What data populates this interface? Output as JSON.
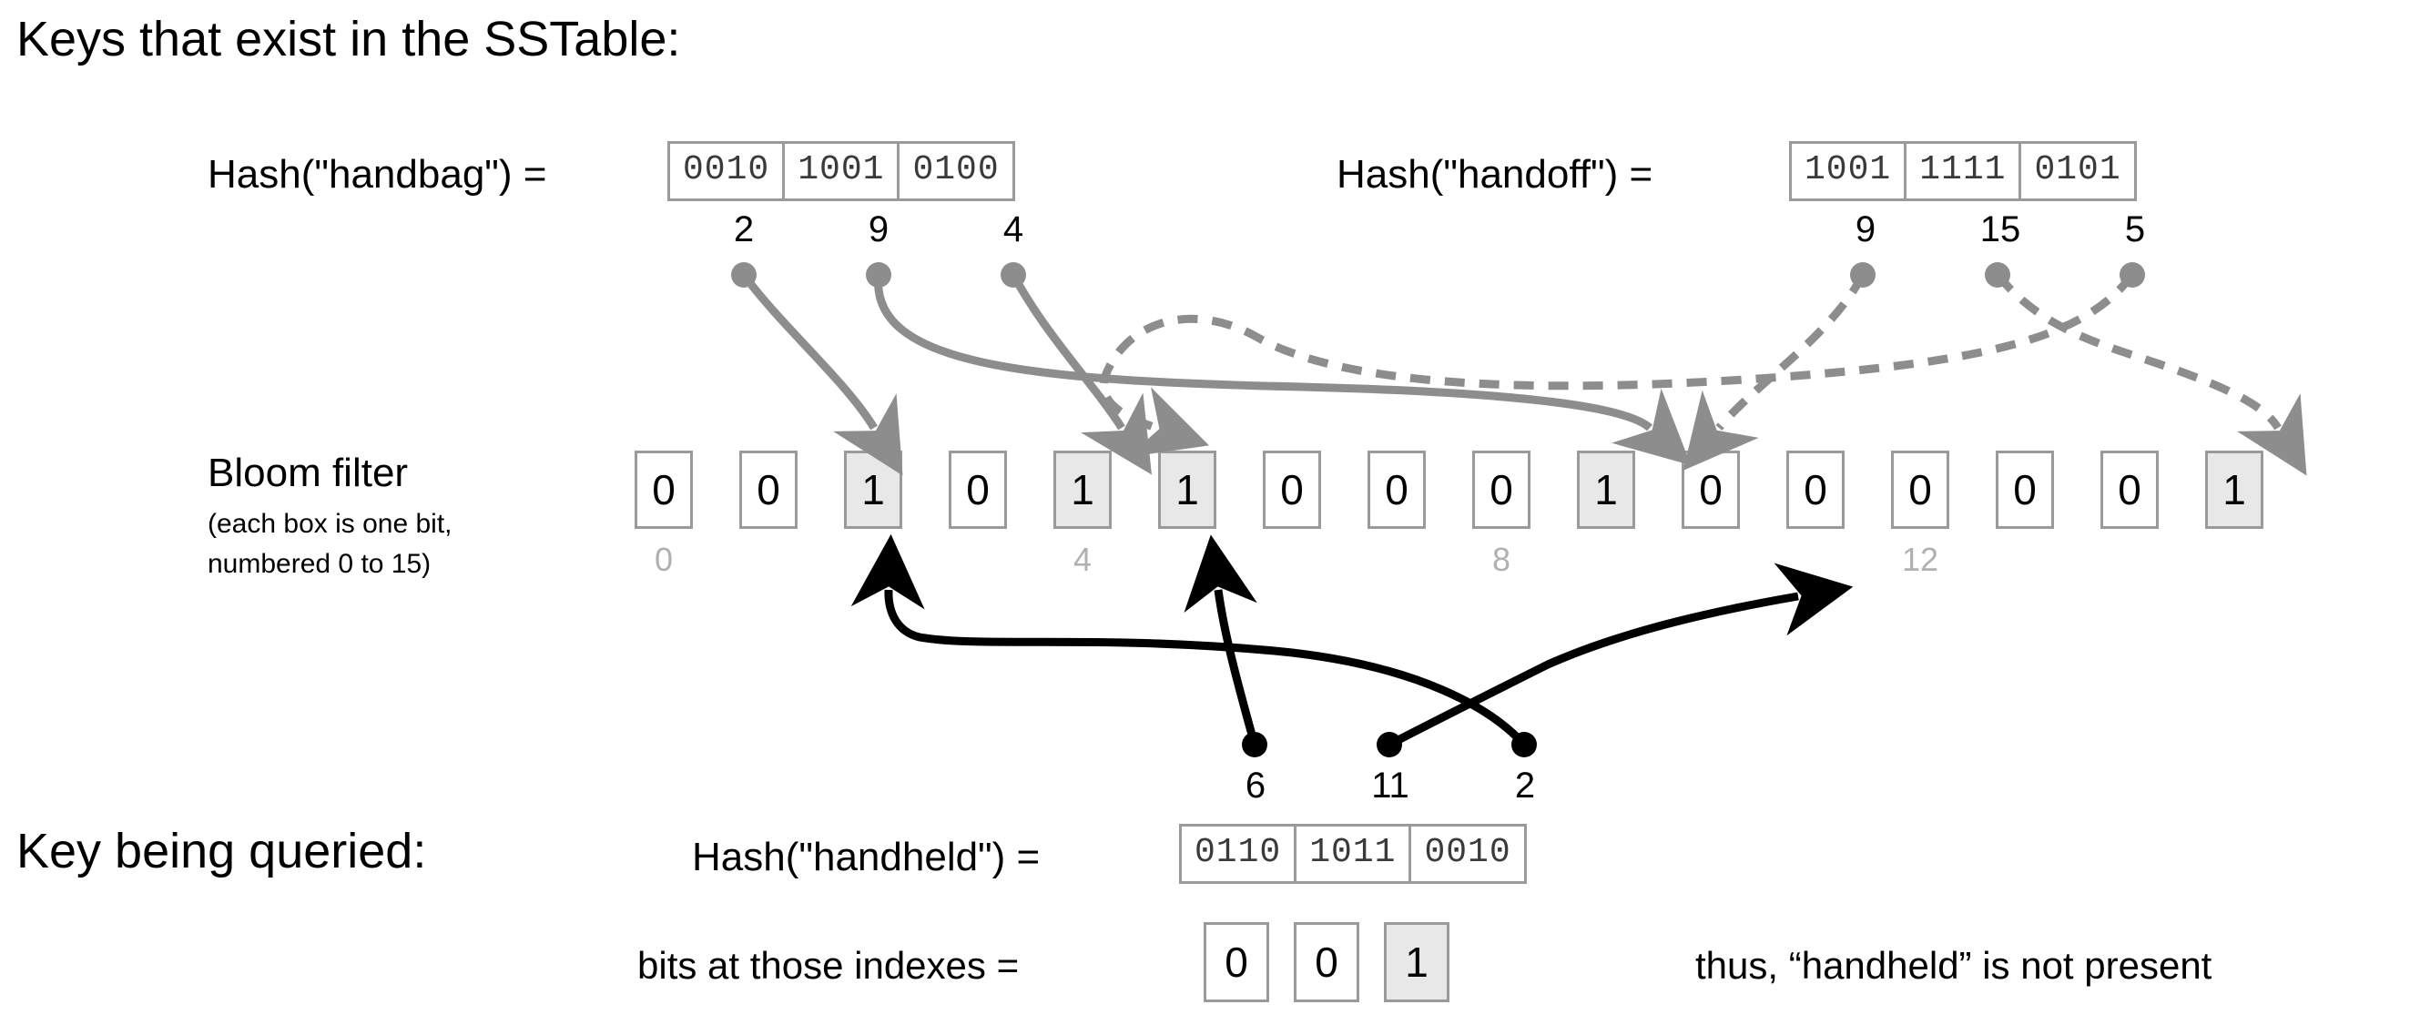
{
  "title_top": "Keys that exist in the SSTable:",
  "title_bottom": "Key being queried:",
  "bloom_filter": {
    "label_main": "Bloom filter",
    "label_sub_line1": "(each box is one bit,",
    "label_sub_line2": "numbered 0 to 15)",
    "bits": [
      "0",
      "0",
      "1",
      "0",
      "1",
      "1",
      "0",
      "0",
      "0",
      "1",
      "0",
      "0",
      "0",
      "0",
      "0",
      "1"
    ],
    "set_indexes": [
      2,
      4,
      5,
      9,
      15
    ],
    "axis_labels": [
      "0",
      "4",
      "8",
      "12"
    ],
    "axis_positions": [
      0,
      4,
      8,
      12
    ],
    "size": 16
  },
  "existing_keys": [
    {
      "label": "Hash(\"handbag\") =",
      "nibbles": [
        "0010",
        "1001",
        "0100"
      ],
      "indexes": [
        "2",
        "9",
        "4"
      ],
      "style": "solid"
    },
    {
      "label": "Hash(\"handoff\") =",
      "nibbles": [
        "1001",
        "1111",
        "0101"
      ],
      "indexes": [
        "9",
        "15",
        "5"
      ],
      "style": "dashed"
    }
  ],
  "query": {
    "label": "Hash(\"handheld\") =",
    "nibbles": [
      "0110",
      "1011",
      "0010"
    ],
    "indexes": [
      "6",
      "11",
      "2"
    ],
    "result_label": "bits at those indexes =",
    "result_bits": [
      "0",
      "0",
      "1"
    ],
    "result_set_indexes": [
      2
    ],
    "conclusion": "thus, “handheld” is not present"
  },
  "colors": {
    "box_border": "#9a9a9a",
    "set_fill": "#e8e8e8",
    "arrow_gray": "#8d8d8d",
    "arrow_black": "#000000",
    "axis_label": "#b0b0b0",
    "nibble_text": "#3a3a3a"
  }
}
